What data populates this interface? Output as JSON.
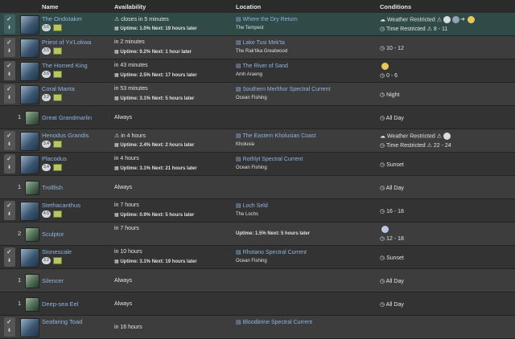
{
  "headers": {
    "name": "Name",
    "availability": "Availability",
    "location": "Location",
    "conditions": "Conditions"
  },
  "rows": [
    {
      "name": "The Ondotaker",
      "bite": "3.6",
      "avail": "closes in 5 minutes",
      "avail_warn": true,
      "uptime": "Uptime: 1.0%",
      "next": "Next: 19 hours later",
      "loc": "Where the Dry Return",
      "region": "The Tempest",
      "c1": "Weather Restricted",
      "c1w": true,
      "c2": "Time Restricted",
      "c2w": true,
      "c2v": "8 - 11"
    },
    {
      "name": "Priest of Yx'Lokwa",
      "bite": "3.5",
      "avail": "in 2 minutes",
      "uptime": "Uptime: 9.2%",
      "next": "Next: 1 hour later",
      "loc": "Lake Tusi Mek'ta",
      "region": "The Rak'tika Greatwood",
      "c2": "10 - 12"
    },
    {
      "name": "The Horned King",
      "bite": "3.6",
      "avail": "in 43 minutes",
      "uptime": "Uptime: 2.5%",
      "next": "Next: 17 hours later",
      "loc": "The River of Sand",
      "region": "Amh Araeng",
      "c2": "0 - 6"
    },
    {
      "name": "Coral Manta",
      "bite": "3.2",
      "avail": "in 53 minutes",
      "uptime": "Uptime: 3.1%",
      "next": "Next: 5 hours later",
      "loc": "Southern Merlthor Spectral Current",
      "region": "Ocean Fishing",
      "c2": "Night"
    },
    {
      "count": "1",
      "name": "Great Grandmarlin",
      "avail": "Always",
      "c2": "All Day"
    },
    {
      "name": "Henodus Grandis",
      "bite": "3.4",
      "avail": "in 4 hours",
      "avail_warn": true,
      "uptime": "Uptime: 2.4%",
      "next": "Next: 2 hours later",
      "loc": "The Eastern Kholusian Coast",
      "region": "Kholusia",
      "c1": "Weather Restricted",
      "c1w": true,
      "c2": "Time Restricted",
      "c2w": true,
      "c2v": "22 - 24"
    },
    {
      "name": "Placodus",
      "bite": "3.4",
      "avail": "in 4 hours",
      "uptime": "Uptime: 3.1%",
      "next": "Next: 21 hours later",
      "loc": "Rothlyt Spectral Current",
      "region": "Ocean Fishing",
      "c2": "Sunset"
    },
    {
      "count": "1",
      "name": "Trollfish",
      "avail": "Always",
      "c2": "All Day"
    },
    {
      "name": "Stethacanthus",
      "bite": "4.5",
      "avail": "in 7 hours",
      "uptime": "Uptime: 0.9%",
      "next": "Next: 5 hours later",
      "loc": "Loch Seld",
      "region": "The Lochs",
      "c2": "16 - 18"
    },
    {
      "count": "2",
      "name": "Sculptor",
      "avail": "in 7 hours",
      "uptime2": "Uptime: 1.5%",
      "next2": "Next: 5 hours later",
      "c2": "12 - 18"
    },
    {
      "name": "Stonescale",
      "bite": "3.2",
      "avail": "in 10 hours",
      "uptime": "Uptime: 3.1%",
      "next": "Next: 19 hours later",
      "loc": "Rhotano Spectral Current",
      "region": "Ocean Fishing",
      "c2": "Sunset"
    },
    {
      "count": "1",
      "name": "Silencer",
      "avail": "Always",
      "c2": "All Day"
    },
    {
      "count": "1",
      "name": "Deep-sea Eel",
      "avail": "Always",
      "c2": "All Day"
    },
    {
      "name": "Seafaring Toad",
      "avail": "in 16 hours",
      "loc": "Bloodbrine Spectral Current"
    }
  ],
  "icons": {
    "check": "✓",
    "download": "⬇",
    "warning": "⚠",
    "map": "map-icon",
    "clock": "clock-icon"
  }
}
